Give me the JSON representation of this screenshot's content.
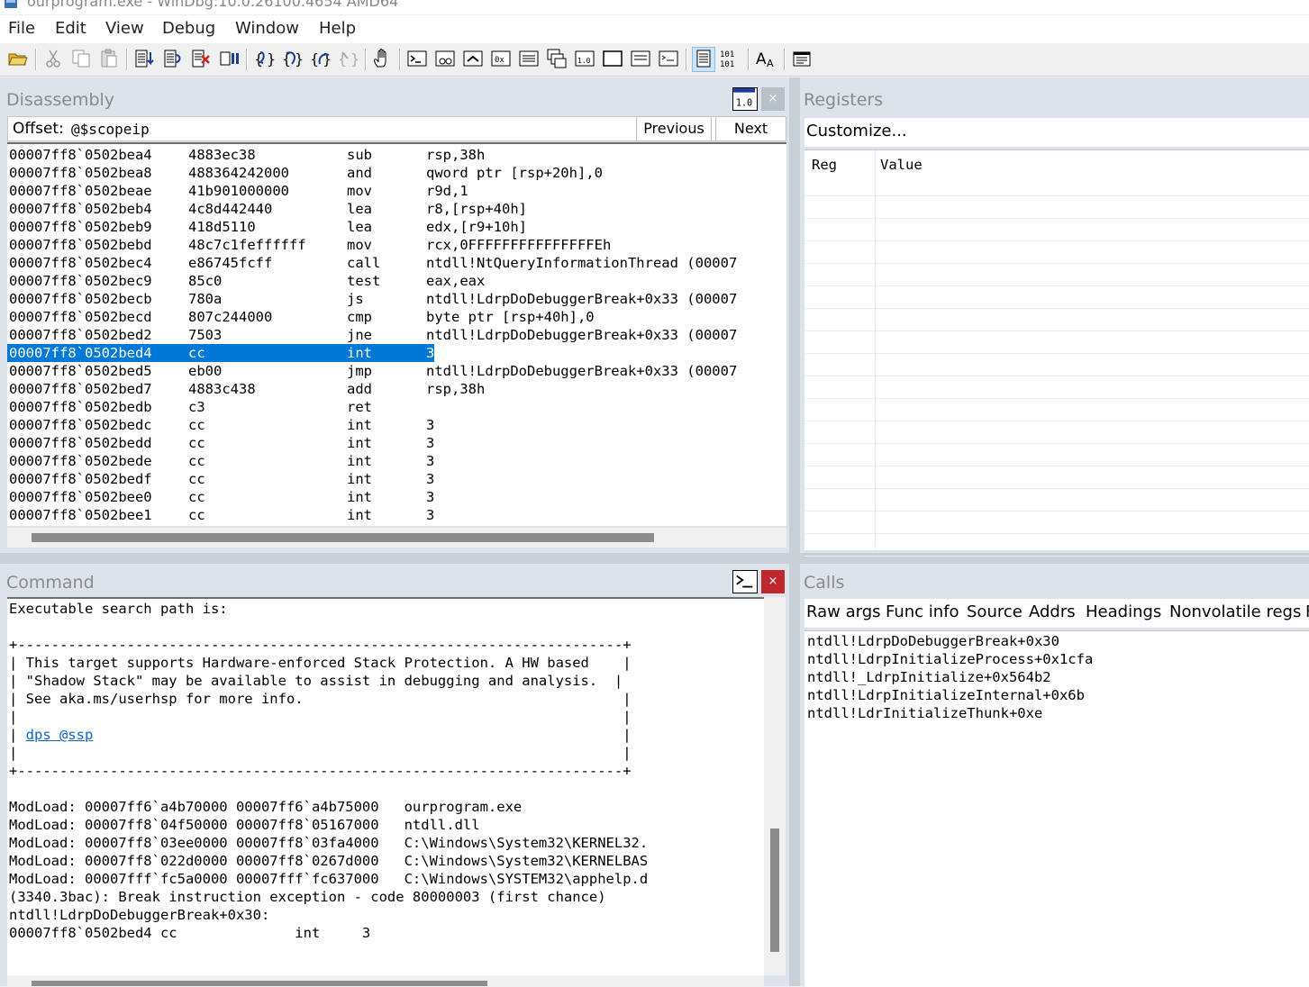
{
  "window": {
    "title": "ourprogram.exe - WinDbg:10.0.26100.4654 AMD64"
  },
  "menu": [
    "File",
    "Edit",
    "View",
    "Debug",
    "Window",
    "Help"
  ],
  "disassembly": {
    "title": "Disassembly",
    "offset_label": "Offset:",
    "offset_value": "@$scopeip",
    "previous_label": "Previous",
    "next_label": "Next",
    "lines": [
      {
        "addr": "00007ff8`0502bea4",
        "bytes": "4883ec38",
        "op": "sub",
        "args": "rsp,38h"
      },
      {
        "addr": "00007ff8`0502bea8",
        "bytes": "488364242000",
        "op": "and",
        "args": "qword ptr [rsp+20h],0"
      },
      {
        "addr": "00007ff8`0502beae",
        "bytes": "41b901000000",
        "op": "mov",
        "args": "r9d,1"
      },
      {
        "addr": "00007ff8`0502beb4",
        "bytes": "4c8d442440",
        "op": "lea",
        "args": "r8,[rsp+40h]"
      },
      {
        "addr": "00007ff8`0502beb9",
        "bytes": "418d5110",
        "op": "lea",
        "args": "edx,[r9+10h]"
      },
      {
        "addr": "00007ff8`0502bebd",
        "bytes": "48c7c1feffffff",
        "op": "mov",
        "args": "rcx,0FFFFFFFFFFFFFFFEh"
      },
      {
        "addr": "00007ff8`0502bec4",
        "bytes": "e86745fcff",
        "op": "call",
        "args": "ntdll!NtQueryInformationThread (00007"
      },
      {
        "addr": "00007ff8`0502bec9",
        "bytes": "85c0",
        "op": "test",
        "args": "eax,eax"
      },
      {
        "addr": "00007ff8`0502becb",
        "bytes": "780a",
        "op": "js",
        "args": "ntdll!LdrpDoDebuggerBreak+0x33 (00007"
      },
      {
        "addr": "00007ff8`0502becd",
        "bytes": "807c244000",
        "op": "cmp",
        "args": "byte ptr [rsp+40h],0"
      },
      {
        "addr": "00007ff8`0502bed2",
        "bytes": "7503",
        "op": "jne",
        "args": "ntdll!LdrpDoDebuggerBreak+0x33 (00007"
      },
      {
        "addr": "00007ff8`0502bed4",
        "bytes": "cc",
        "op": "int",
        "args": "3",
        "selected": true
      },
      {
        "addr": "00007ff8`0502bed5",
        "bytes": "eb00",
        "op": "jmp",
        "args": "ntdll!LdrpDoDebuggerBreak+0x33 (00007"
      },
      {
        "addr": "00007ff8`0502bed7",
        "bytes": "4883c438",
        "op": "add",
        "args": "rsp,38h"
      },
      {
        "addr": "00007ff8`0502bedb",
        "bytes": "c3",
        "op": "ret",
        "args": ""
      },
      {
        "addr": "00007ff8`0502bedc",
        "bytes": "cc",
        "op": "int",
        "args": "3"
      },
      {
        "addr": "00007ff8`0502bedd",
        "bytes": "cc",
        "op": "int",
        "args": "3"
      },
      {
        "addr": "00007ff8`0502bede",
        "bytes": "cc",
        "op": "int",
        "args": "3"
      },
      {
        "addr": "00007ff8`0502bedf",
        "bytes": "cc",
        "op": "int",
        "args": "3"
      },
      {
        "addr": "00007ff8`0502bee0",
        "bytes": "cc",
        "op": "int",
        "args": "3"
      },
      {
        "addr": "00007ff8`0502bee1",
        "bytes": "cc",
        "op": "int",
        "args": "3"
      }
    ]
  },
  "registers": {
    "title": "Registers",
    "customize_label": "Customize...",
    "col_reg": "Reg",
    "col_value": "Value"
  },
  "command": {
    "title": "Command",
    "lines": [
      "Executable search path is:",
      "",
      "+------------------------------------------------------------------------+",
      "| This target supports Hardware-enforced Stack Protection. A HW based    |",
      "| \"Shadow Stack\" may be available to assist in debugging and analysis.  |",
      "| See aka.ms/userhsp for more info.                                      |",
      "|                                                                        |",
      "| dps @ssp                                                               |",
      "|                                                                        |",
      "+------------------------------------------------------------------------+",
      "",
      "ModLoad: 00007ff6`a4b70000 00007ff6`a4b75000   ourprogram.exe",
      "ModLoad: 00007ff8`04f50000 00007ff8`05167000   ntdll.dll",
      "ModLoad: 00007ff8`03ee0000 00007ff8`03fa4000   C:\\Windows\\System32\\KERNEL32.",
      "ModLoad: 00007ff8`022d0000 00007ff8`0267d000   C:\\Windows\\System32\\KERNELBAS",
      "ModLoad: 00007fff`fc5a0000 00007fff`fc637000   C:\\Windows\\SYSTEM32\\apphelp.d",
      "(3340.3bac): Break instruction exception - code 80000003 (first chance)",
      "ntdll!LdrpDoDebuggerBreak+0x30:",
      "00007ff8`0502bed4 cc              int     3"
    ],
    "link_text": "dps @ssp"
  },
  "calls": {
    "title": "Calls",
    "tabs": [
      "Raw args",
      "Func info",
      "Source",
      "Addrs",
      "Headings",
      "Nonvolatile regs",
      "F"
    ],
    "frames": [
      "ntdll!LdrpDoDebuggerBreak+0x30",
      "ntdll!LdrpInitializeProcess+0x1cfa",
      "ntdll!_LdrpInitialize+0x564b2",
      "ntdll!LdrpInitializeInternal+0x6b",
      "ntdll!LdrInitializeThunk+0xe"
    ]
  },
  "toolbar": {
    "icons": [
      "open-folder-icon",
      "cut-icon",
      "copy-icon",
      "paste-icon",
      "step-into-source-icon",
      "step-over-source-icon",
      "stop-debugging-icon",
      "break-icon",
      "step-into-icon",
      "step-over-icon",
      "step-out-icon",
      "run-to-cursor-icon",
      "hand-icon",
      "command-window-icon",
      "watch-window-icon",
      "locals-window-icon",
      "registers-window-icon",
      "memory-window-icon",
      "call-stack-icon",
      "disassembly-window-icon",
      "scratch-pad-icon",
      "processes-threads-icon",
      "source-mode-icon",
      "hex-display-icon",
      "font-icon",
      "options-icon"
    ]
  },
  "colors": {
    "selection": "#0078d7",
    "link": "#0b63c6",
    "close_button": "#c0272d"
  }
}
